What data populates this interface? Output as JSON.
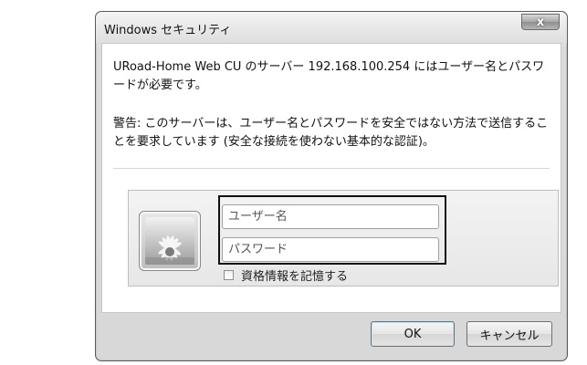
{
  "window": {
    "title": "Windows セキュリティ",
    "close_symbol": "x"
  },
  "message": {
    "line1": "URoad-Home Web CU のサーバー 192.168.100.254 にはユーザー名とパスワードが必要です。",
    "warning": "警告: このサーバーは、ユーザー名とパスワードを安全ではない方法で送信することを要求しています (安全な接続を使わない基本的な認証)。"
  },
  "credentials": {
    "username_placeholder": "ユーザー名",
    "password_placeholder": "パスワード",
    "remember_label": "資格情報を記憶する"
  },
  "buttons": {
    "ok": "OK",
    "cancel": "キャンセル"
  },
  "icons": {
    "avatar": "user-flower-icon",
    "close": "close-icon"
  }
}
